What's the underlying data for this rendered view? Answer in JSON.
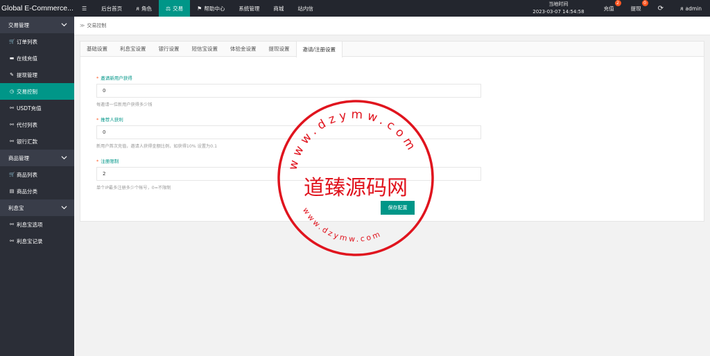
{
  "app": {
    "brand": "Global E-Commerce..."
  },
  "topnav": [
    {
      "icon": "☰",
      "label": ""
    },
    {
      "icon": "",
      "label": "后台首页"
    },
    {
      "icon": "ᴙ",
      "label": "角色"
    },
    {
      "icon": "⚖",
      "label": "交易"
    },
    {
      "icon": "⚑",
      "label": "帮助中心"
    },
    {
      "icon": "",
      "label": "系统管理"
    },
    {
      "icon": "",
      "label": "商城"
    },
    {
      "icon": "",
      "label": "站内信"
    }
  ],
  "topright": {
    "time_label": "当地时间",
    "time_value": "2023-03-07 14:54:58",
    "recharge_label": "充值",
    "recharge_badge": "2",
    "withdraw_label": "提现",
    "withdraw_badge": "0",
    "refresh_icon": "⟳",
    "user_label": "admin"
  },
  "sidebar": {
    "groups": [
      {
        "label": "交易管理",
        "items": [
          {
            "icon": "🛒",
            "label": "订单列表"
          },
          {
            "icon": "▬",
            "label": "在线充值"
          },
          {
            "icon": "✎",
            "label": "提现管理"
          },
          {
            "icon": "◷",
            "label": "交易控制"
          },
          {
            "icon": "⚯",
            "label": "USDT充值"
          },
          {
            "icon": "⚯",
            "label": "代付列表"
          },
          {
            "icon": "⚯",
            "label": "银行汇款"
          }
        ]
      },
      {
        "label": "商品管理",
        "items": [
          {
            "icon": "🛒",
            "label": "商品列表"
          },
          {
            "icon": "▤",
            "label": "商品分类"
          }
        ]
      },
      {
        "label": "利息宝",
        "items": [
          {
            "icon": "⚯",
            "label": "利息宝选项"
          },
          {
            "icon": "⚯",
            "label": "利息宝记录"
          }
        ]
      }
    ]
  },
  "breadcrumb": {
    "sep": "≫",
    "label": "交易控制"
  },
  "tabs": [
    "基础设置",
    "利息宝设置",
    "银行设置",
    "短信宝设置",
    "体验金设置",
    "提现设置",
    "邀请/注册设置"
  ],
  "form": {
    "fields": [
      {
        "label": "邀请新用户获得",
        "value": "0",
        "help": "每邀请一位新用户获得多少钱"
      },
      {
        "label": "推荐人获利",
        "value": "0",
        "help": "新用户首次充值，邀请人获得金额比例，如获得10% 设置为0.1"
      },
      {
        "label": "注册限制",
        "value": "2",
        "help": "单个IP最多注册多少个帐号，0=不限制"
      }
    ],
    "save_label": "保存配置"
  },
  "watermark": {
    "center_text": "道臻源码网",
    "ring_top": "www.dzymw.com",
    "ring_bottom": "www.dzymw.com",
    "color": "#e0141e"
  },
  "colors": {
    "accent": "#009688",
    "topbar": "#23262e",
    "sidebar": "#393d49",
    "badge": "#ff5722"
  }
}
